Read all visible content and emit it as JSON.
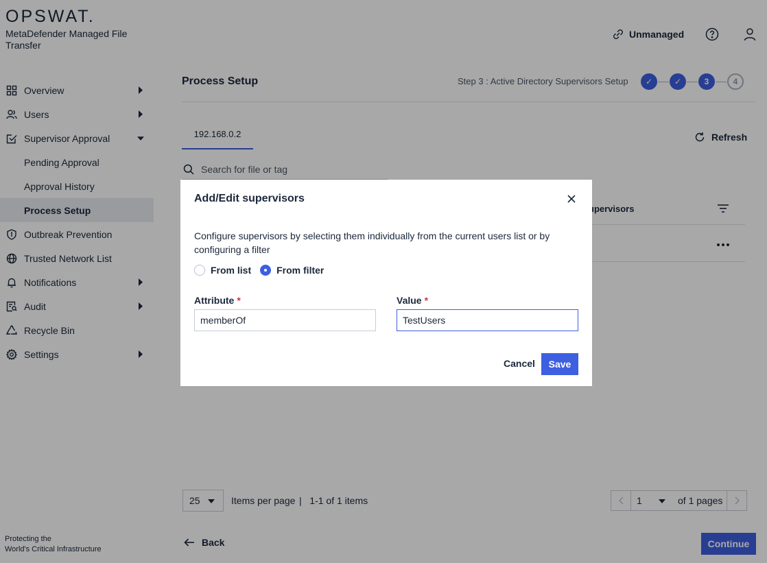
{
  "brand": {
    "logo": "OPSWAT.",
    "product": "MetaDefender Managed File Transfer",
    "tagline_line1": "Protecting the",
    "tagline_line2": "World's Critical Infrastructure"
  },
  "sidebar": {
    "items": [
      {
        "label": "Overview",
        "icon": "grid-icon",
        "caret": "right"
      },
      {
        "label": "Users",
        "icon": "users-icon",
        "caret": "right"
      },
      {
        "label": "Supervisor Approval",
        "icon": "approval-check-icon",
        "caret": "down"
      },
      {
        "label": "Pending Approval"
      },
      {
        "label": "Approval History"
      },
      {
        "label": "Process Setup",
        "active": true
      },
      {
        "label": "Outbreak Prevention",
        "icon": "shield-icon"
      },
      {
        "label": "Trusted Network List",
        "icon": "globe-icon"
      },
      {
        "label": "Notifications",
        "icon": "bell-icon",
        "caret": "right"
      },
      {
        "label": "Audit",
        "icon": "audit-icon",
        "caret": "right"
      },
      {
        "label": "Recycle Bin",
        "icon": "recycle-icon"
      },
      {
        "label": "Settings",
        "icon": "gear-icon",
        "caret": "right"
      }
    ]
  },
  "topbar": {
    "unmanaged_label": "Unmanaged",
    "icons": [
      "unlink-icon",
      "help-icon",
      "user-icon"
    ]
  },
  "main": {
    "title": "Process Setup",
    "step_label": "Step 3 : Active Directory Supervisors Setup",
    "steps": [
      "✓",
      "✓",
      "3",
      "4"
    ],
    "current_step": 3,
    "tab_label": "192.168.0.2",
    "refresh_label": "Refresh",
    "search_placeholder": "Search for file or tag",
    "column_header": "upervisors",
    "pagination": {
      "per_page": "25",
      "per_page_label": "Items per page",
      "range_label": "|   1-1 of 1 items",
      "page": "1",
      "of_pages": "of 1 pages"
    },
    "back_label": "Back",
    "continue_label": "Continue"
  },
  "modal": {
    "title": "Add/Edit supervisors",
    "description": "Configure supervisors by selecting them individually from the current users list or by configuring a filter",
    "radio_from_list": "From list",
    "radio_from_filter": "From filter",
    "selected_mode": "From filter",
    "attribute_label": "Attribute",
    "attribute_value": "memberOf",
    "value_label": "Value",
    "value_value": "TestUsers",
    "required_marker": "*",
    "cancel_label": "Cancel",
    "save_label": "Save"
  },
  "colors": {
    "accent": "#3d5fe0",
    "required": "#d0353a",
    "text": "#1b273a",
    "active_nav_bg": "#e8ebf1"
  }
}
